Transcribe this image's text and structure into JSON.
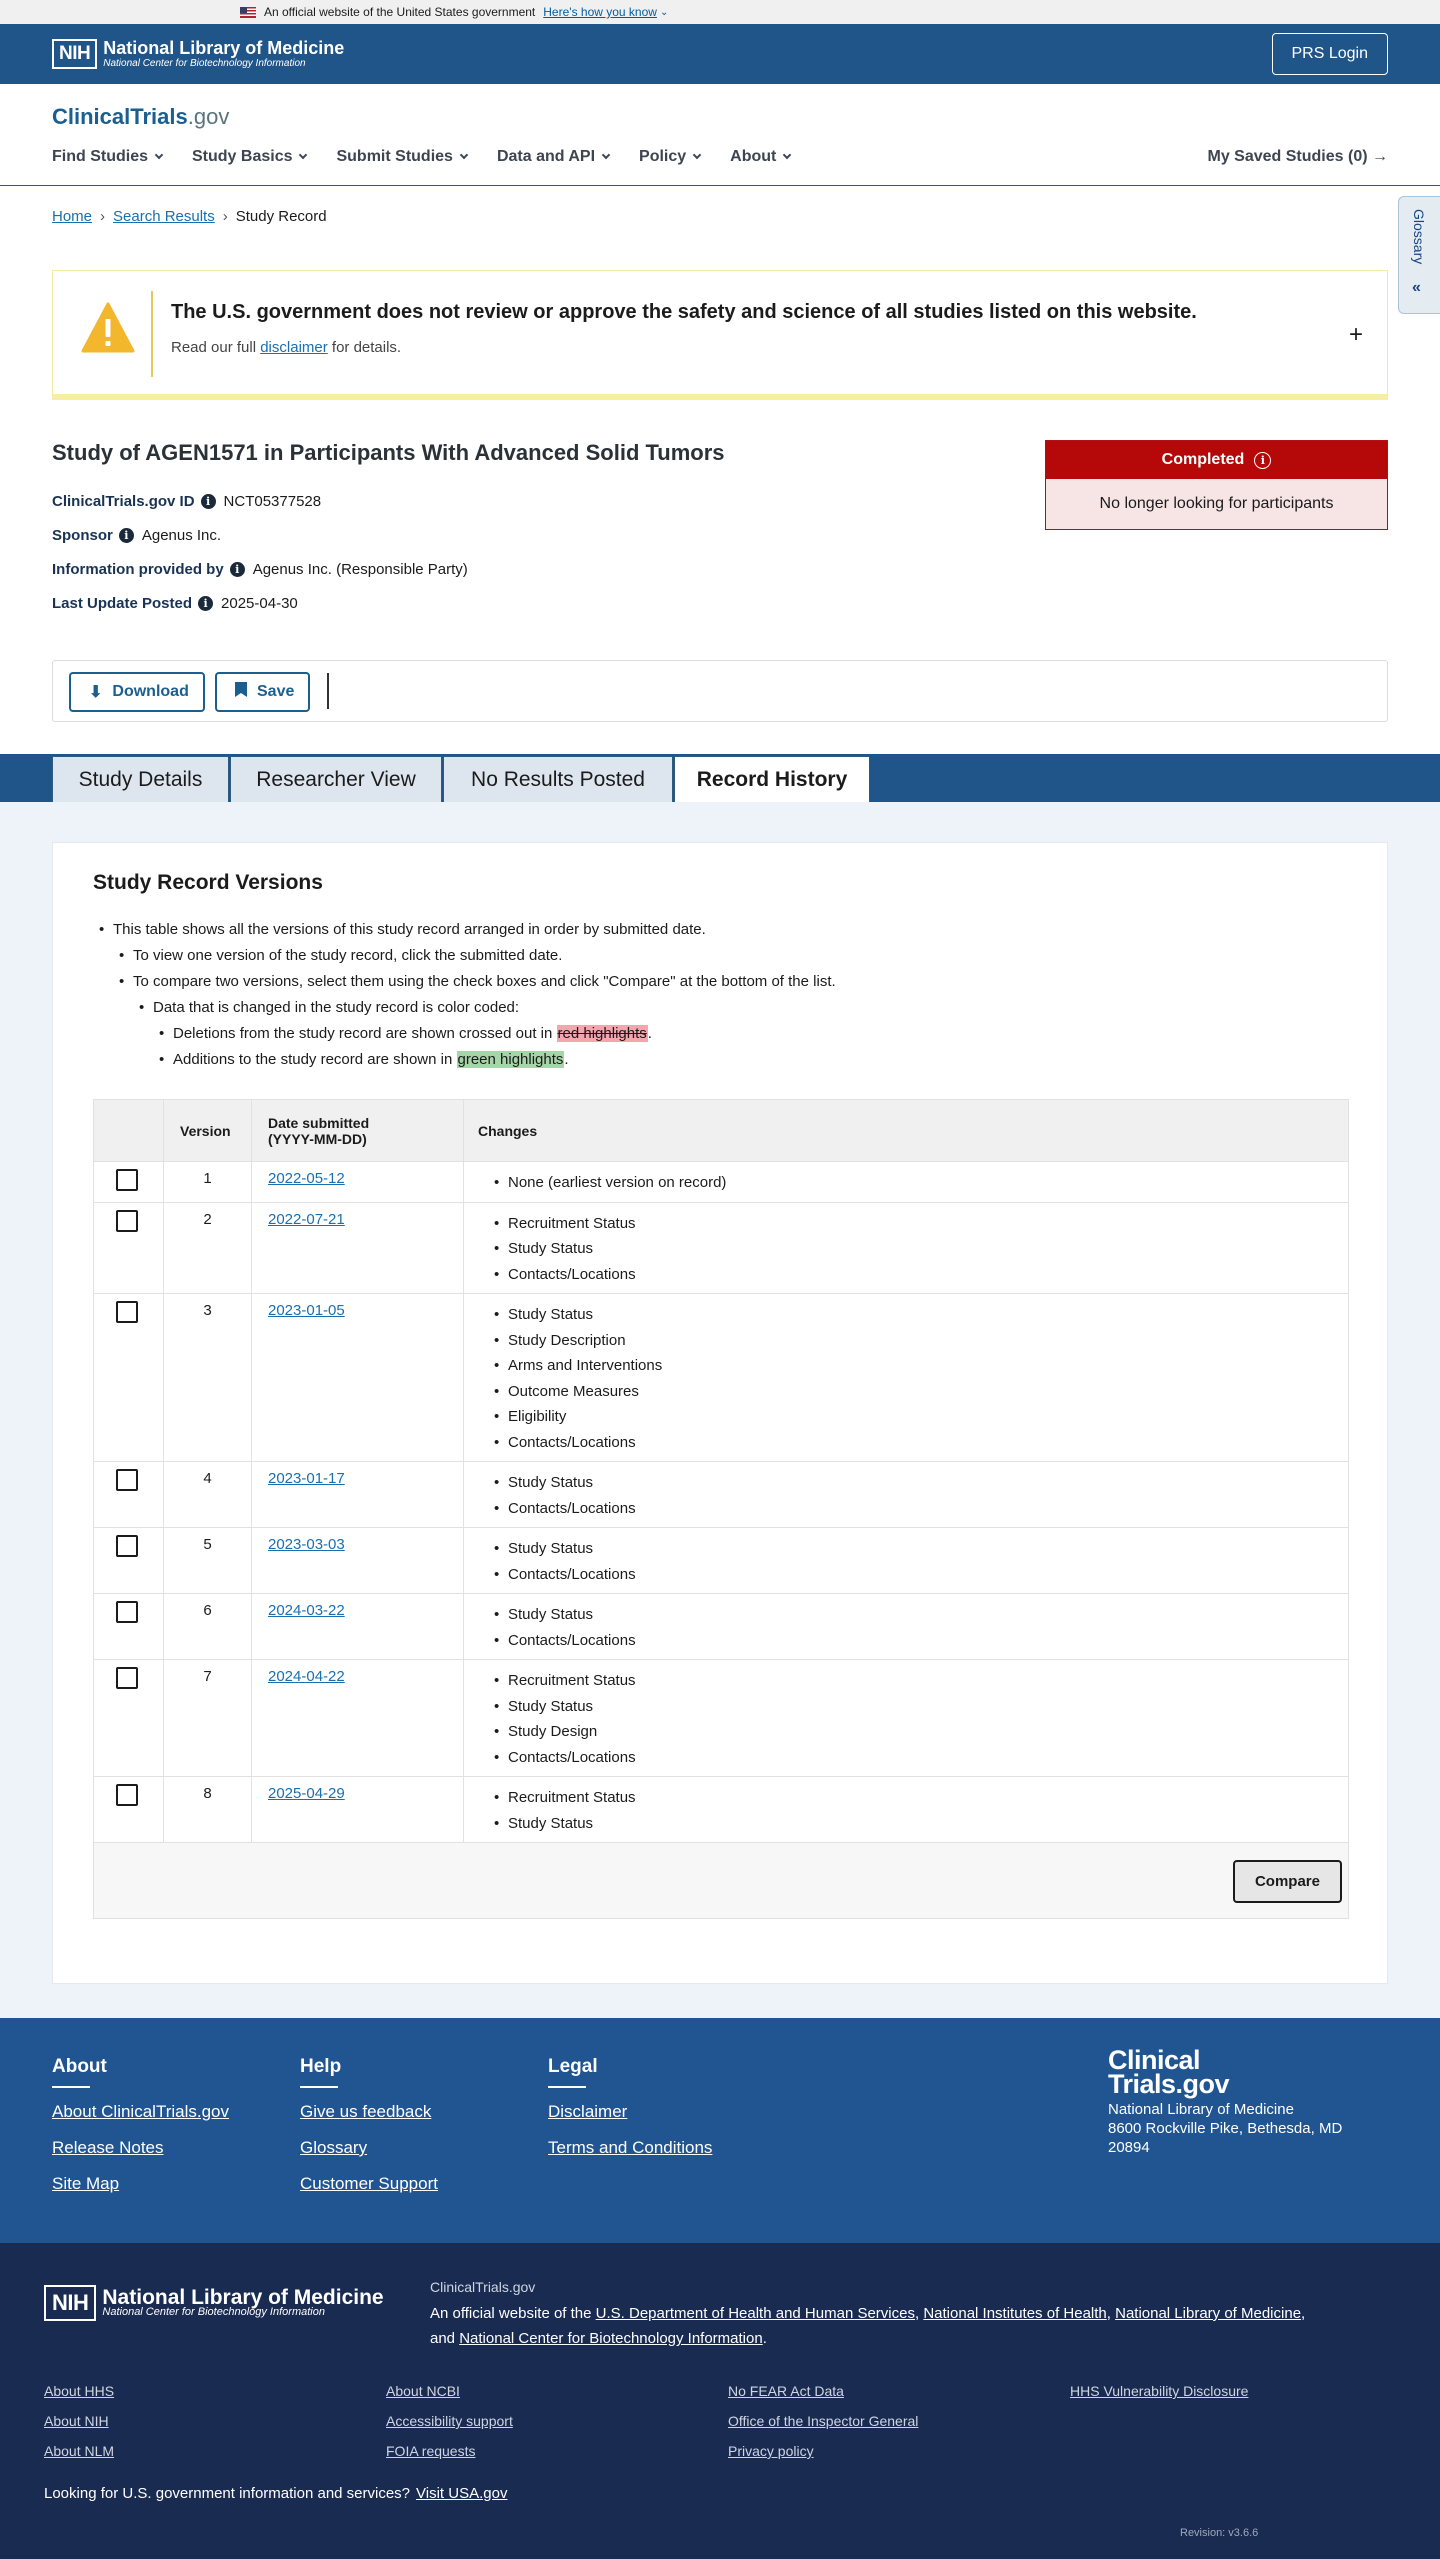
{
  "gov_banner": {
    "text": "An official website of the United States government",
    "link": "Here's how you know"
  },
  "nih_header": {
    "logo_box": "NIH",
    "logo_title": "National Library of Medicine",
    "logo_subtitle": "National Center for Biotechnology Information",
    "login_label": "PRS Login"
  },
  "site": {
    "logo_main": "ClinicalTrials",
    "logo_suffix": ".gov",
    "nav": [
      "Find Studies",
      "Study Basics",
      "Submit Studies",
      "Data and API",
      "Policy",
      "About"
    ],
    "saved": "My Saved Studies (0)",
    "glossary": "Glossary"
  },
  "breadcrumb": {
    "home": "Home",
    "search": "Search Results",
    "current": "Study Record"
  },
  "disclaimer": {
    "title": "The U.S. government does not review or approve the safety and science of all studies listed on this website.",
    "pre": "Read our full ",
    "link": "disclaimer",
    "post": " for details."
  },
  "study": {
    "title": "Study of AGEN1571 in Participants With Advanced Solid Tumors",
    "id_label": "ClinicalTrials.gov ID",
    "id_value": "NCT05377528",
    "sponsor_label": "Sponsor",
    "sponsor_value": "Agenus Inc.",
    "provided_label": "Information provided by",
    "provided_value": "Agenus Inc. (Responsible Party)",
    "update_label": "Last Update Posted",
    "update_value": "2025-04-30",
    "status": "Completed",
    "status_detail": "No longer looking for participants"
  },
  "actions": {
    "download": "Download",
    "save": "Save"
  },
  "tabs": [
    "Study Details",
    "Researcher View",
    "No Results Posted",
    "Record History"
  ],
  "versions": {
    "title": "Study Record Versions",
    "bullets": {
      "b1": "This table shows all the versions of this study record arranged in order by submitted date.",
      "b2": "To view one version of the study record, click the submitted date.",
      "b3": "To compare two versions, select them using the check boxes and click \"Compare\" at the bottom of the list.",
      "b4": "Data that is changed in the study record is color coded:",
      "b5_pre": "Deletions from the study record are shown crossed out in ",
      "b5_hl": "red highlights",
      "b5_post": ".",
      "b6_pre": "Additions to the study record are shown in ",
      "b6_hl": "green highlights",
      "b6_post": "."
    },
    "headers": {
      "version": "Version",
      "date_l1": "Date submitted",
      "date_l2": "(YYYY-MM-DD)",
      "changes": "Changes"
    },
    "rows": [
      {
        "version": "1",
        "date": "2022-05-12",
        "changes": [
          "None (earliest version on record)"
        ]
      },
      {
        "version": "2",
        "date": "2022-07-21",
        "changes": [
          "Recruitment Status",
          "Study Status",
          "Contacts/Locations"
        ]
      },
      {
        "version": "3",
        "date": "2023-01-05",
        "changes": [
          "Study Status",
          "Study Description",
          "Arms and Interventions",
          "Outcome Measures",
          "Eligibility",
          "Contacts/Locations"
        ]
      },
      {
        "version": "4",
        "date": "2023-01-17",
        "changes": [
          "Study Status",
          "Contacts/Locations"
        ]
      },
      {
        "version": "5",
        "date": "2023-03-03",
        "changes": [
          "Study Status",
          "Contacts/Locations"
        ]
      },
      {
        "version": "6",
        "date": "2024-03-22",
        "changes": [
          "Study Status",
          "Contacts/Locations"
        ]
      },
      {
        "version": "7",
        "date": "2024-04-22",
        "changes": [
          "Recruitment Status",
          "Study Status",
          "Study Design",
          "Contacts/Locations"
        ]
      },
      {
        "version": "8",
        "date": "2025-04-29",
        "changes": [
          "Recruitment Status",
          "Study Status"
        ]
      }
    ],
    "compare": "Compare"
  },
  "footer": {
    "about": {
      "title": "About",
      "links": [
        "About ClinicalTrials.gov",
        "Release Notes",
        "Site Map"
      ]
    },
    "help": {
      "title": "Help",
      "links": [
        "Give us feedback",
        "Glossary",
        "Customer Support"
      ]
    },
    "legal": {
      "title": "Legal",
      "links": [
        "Disclaimer",
        "Terms and Conditions"
      ]
    },
    "logo_l1": "Clinical",
    "logo_l2": "Trials.gov",
    "org": "National Library of Medicine",
    "address": "8600 Rockville Pike, Bethesda, MD 20894"
  },
  "footer_bottom": {
    "nih_box": "NIH",
    "nih_title": "National Library of Medicine",
    "nih_subtitle": "National Center for Biotechnology Information",
    "site": "ClinicalTrials.gov",
    "official_pre": "An official website of the ",
    "official_links": [
      "U.S. Department of Health and Human Services",
      "National Institutes of Health",
      "National Library of Medicine",
      "National Center for Biotechnology Information"
    ],
    "col1": [
      "About HHS",
      "About NIH",
      "About NLM"
    ],
    "col2": [
      "About NCBI",
      "Accessibility support",
      "FOIA requests"
    ],
    "col3": [
      "No FEAR Act Data",
      "Office of the Inspector General",
      "Privacy policy"
    ],
    "col4": [
      "HHS Vulnerability Disclosure"
    ],
    "look": "Looking for U.S. government information and services?",
    "look_link": "Visit USA.gov",
    "revision": "Revision: v3.6.6"
  }
}
